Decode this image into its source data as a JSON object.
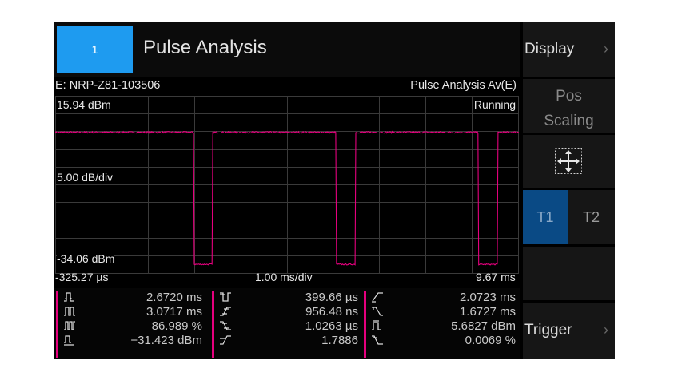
{
  "header": {
    "channel_label": "1",
    "title": "Pulse Analysis"
  },
  "info": {
    "sensor": "E: NRP-Z81-103506",
    "mode": "Pulse Analysis Av(E)"
  },
  "plot": {
    "y_top": "15.94 dBm",
    "status": "Running",
    "y_div": "5.00 dB/div",
    "y_bottom": "-34.06 dBm",
    "x_start": "-325.27 µs",
    "x_div": "1.00 ms/div",
    "x_end": "9.67 ms",
    "trace_color": "#e6007e",
    "grid_color": "#3a3a3a",
    "trace": {
      "x_unit": "ms",
      "y_unit": "dBm",
      "high_level_dbm": 5.7,
      "low_level_dbm": -31.4,
      "pulse_width_ms": 2.672,
      "pulse_period_ms": 3.0717,
      "fall_edges_ms": [
        2.66,
        5.73,
        8.8
      ],
      "rise_edges_ms": [
        0.0,
        3.07,
        6.14,
        9.21
      ]
    }
  },
  "measurements": {
    "col1": [
      "2.6720 ms",
      "3.0717 ms",
      "86.989 %",
      "−31.423 dBm"
    ],
    "col2": [
      "399.66 µs",
      "956.48 ns",
      "1.0263 µs",
      "1.7886"
    ],
    "col3": [
      "2.0723 ms",
      "1.6727 ms",
      "5.6827 dBm",
      "0.0069 %"
    ],
    "bar_color": "#e6007e",
    "icons": {
      "col1": [
        "pulse-width-icon",
        "pulse-period-icon",
        "duty-cycle-icon",
        "pulse-base-level-icon"
      ],
      "col2": [
        "pulse-off-time-icon",
        "rise-time-icon",
        "fall-time-icon",
        "ratio-icon"
      ],
      "col3": [
        "rise-edge-time-icon",
        "fall-edge-time-icon",
        "pulse-top-level-icon",
        "droop-icon"
      ]
    }
  },
  "side": {
    "display": "Display",
    "pos_scaling_line1": "Pos",
    "pos_scaling_line2": "Scaling",
    "move_icon": "move-arrows-icon",
    "t1": "T1",
    "t2": "T2",
    "trigger": "Trigger",
    "chevron": "›"
  }
}
